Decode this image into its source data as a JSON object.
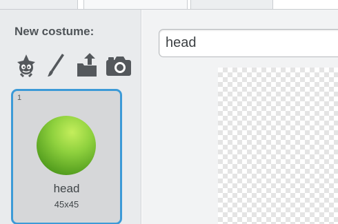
{
  "sidebar": {
    "new_costume_label": "New costume:",
    "tools": [
      {
        "icon": "sprite-library-icon"
      },
      {
        "icon": "paintbrush-icon"
      },
      {
        "icon": "upload-icon"
      },
      {
        "icon": "camera-icon"
      }
    ]
  },
  "costumes": [
    {
      "index": "1",
      "name": "head",
      "size": "45x45",
      "selected": true,
      "color": "#7dc23a"
    }
  ],
  "editor": {
    "costume_name_value": "head"
  },
  "colors": {
    "selection": "#3c9ad7",
    "panel": "#e9ebed",
    "icon": "#54585c"
  }
}
